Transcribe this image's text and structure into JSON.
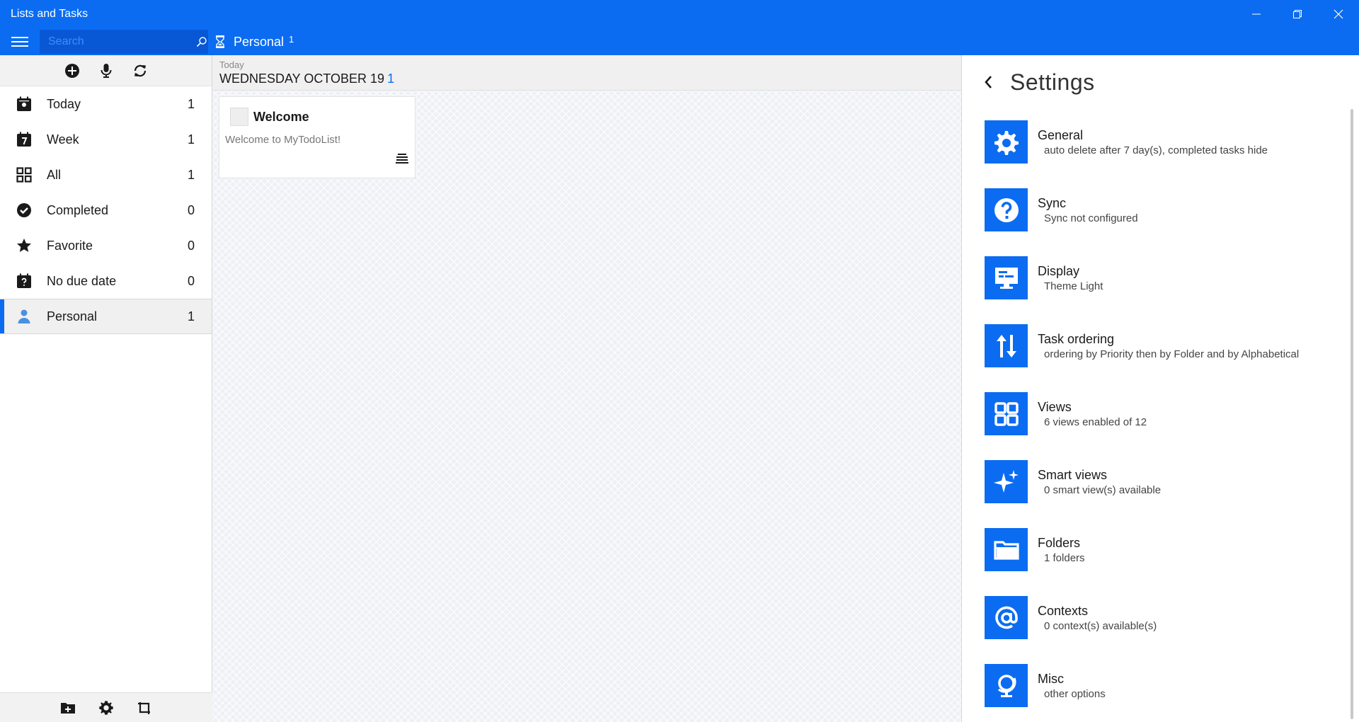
{
  "window": {
    "title": "Lists and Tasks"
  },
  "topbar": {
    "search_placeholder": "Search",
    "folder_name": "Personal",
    "folder_count": "1"
  },
  "sidebar": {
    "items": [
      {
        "label": "Today",
        "count": "1",
        "icon": "calendar-today-icon"
      },
      {
        "label": "Week",
        "count": "1",
        "icon": "calendar-week-icon"
      },
      {
        "label": "All",
        "count": "1",
        "icon": "grid-icon"
      },
      {
        "label": "Completed",
        "count": "0",
        "icon": "check-circle-icon"
      },
      {
        "label": "Favorite",
        "count": "0",
        "icon": "star-icon"
      },
      {
        "label": "No due date",
        "count": "0",
        "icon": "calendar-question-icon"
      },
      {
        "label": "Personal",
        "count": "1",
        "icon": "person-icon"
      }
    ]
  },
  "center": {
    "group_small": "Today",
    "group_date": "WEDNESDAY OCTOBER 19",
    "group_count": "1",
    "task": {
      "title": "Welcome",
      "note": "Welcome to MyTodoList!"
    }
  },
  "settings": {
    "title": "Settings",
    "items": [
      {
        "title": "General",
        "sub": "auto delete after 7 day(s), completed tasks hide",
        "icon": "gear-icon"
      },
      {
        "title": "Sync",
        "sub": "Sync not configured",
        "icon": "question-icon"
      },
      {
        "title": "Display",
        "sub": "Theme Light",
        "icon": "monitor-icon"
      },
      {
        "title": "Task ordering",
        "sub": "ordering by Priority then by Folder and by Alphabetical",
        "icon": "sort-icon"
      },
      {
        "title": "Views",
        "sub": "6 views enabled of 12",
        "icon": "views-grid-icon"
      },
      {
        "title": "Smart views",
        "sub": "0 smart view(s) available",
        "icon": "sparkle-icon"
      },
      {
        "title": "Folders",
        "sub": "1 folders",
        "icon": "folder-icon"
      },
      {
        "title": "Contexts",
        "sub": "0 context(s) available(s)",
        "icon": "at-icon"
      },
      {
        "title": "Misc",
        "sub": "other options",
        "icon": "globe-icon"
      }
    ]
  },
  "colors": {
    "accent": "#0b6cf2"
  }
}
